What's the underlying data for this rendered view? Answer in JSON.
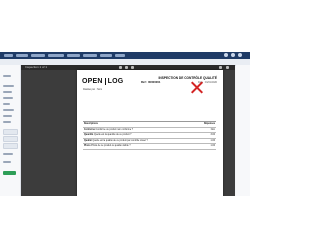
{
  "viewer": {
    "doc_name": "Inspection 1 of 1"
  },
  "document": {
    "logo_left": "OPEN",
    "logo_right": "LOG",
    "title": "INSPECTION DE CONTRÔLE QUALITÉ",
    "ref": "Réf : 00000001",
    "date": "Date : 01/01/2020",
    "author": "Réalisé par : Nom",
    "table": {
      "header_left": "Descriptions",
      "header_right": "Réponses",
      "rows": [
        {
          "key": "Conforme",
          "text": "Conforme ou produit non conforme ?",
          "value": "Non"
        },
        {
          "key": "Quantité",
          "text": "Quelle est la quantité de ce produit ?",
          "value": "3.00"
        },
        {
          "key": "Qualité",
          "text": "Quelle est la qualité de ce produit par contrôle visuel ?",
          "value": "1.00"
        },
        {
          "key": "Photo",
          "text": "Photo de ce produit ou qualité visible ?",
          "value": "1.00"
        }
      ]
    }
  },
  "colors": {
    "topbar": "#1f3b66",
    "accent_green": "#2e9e57",
    "cross_red": "#d32424"
  }
}
